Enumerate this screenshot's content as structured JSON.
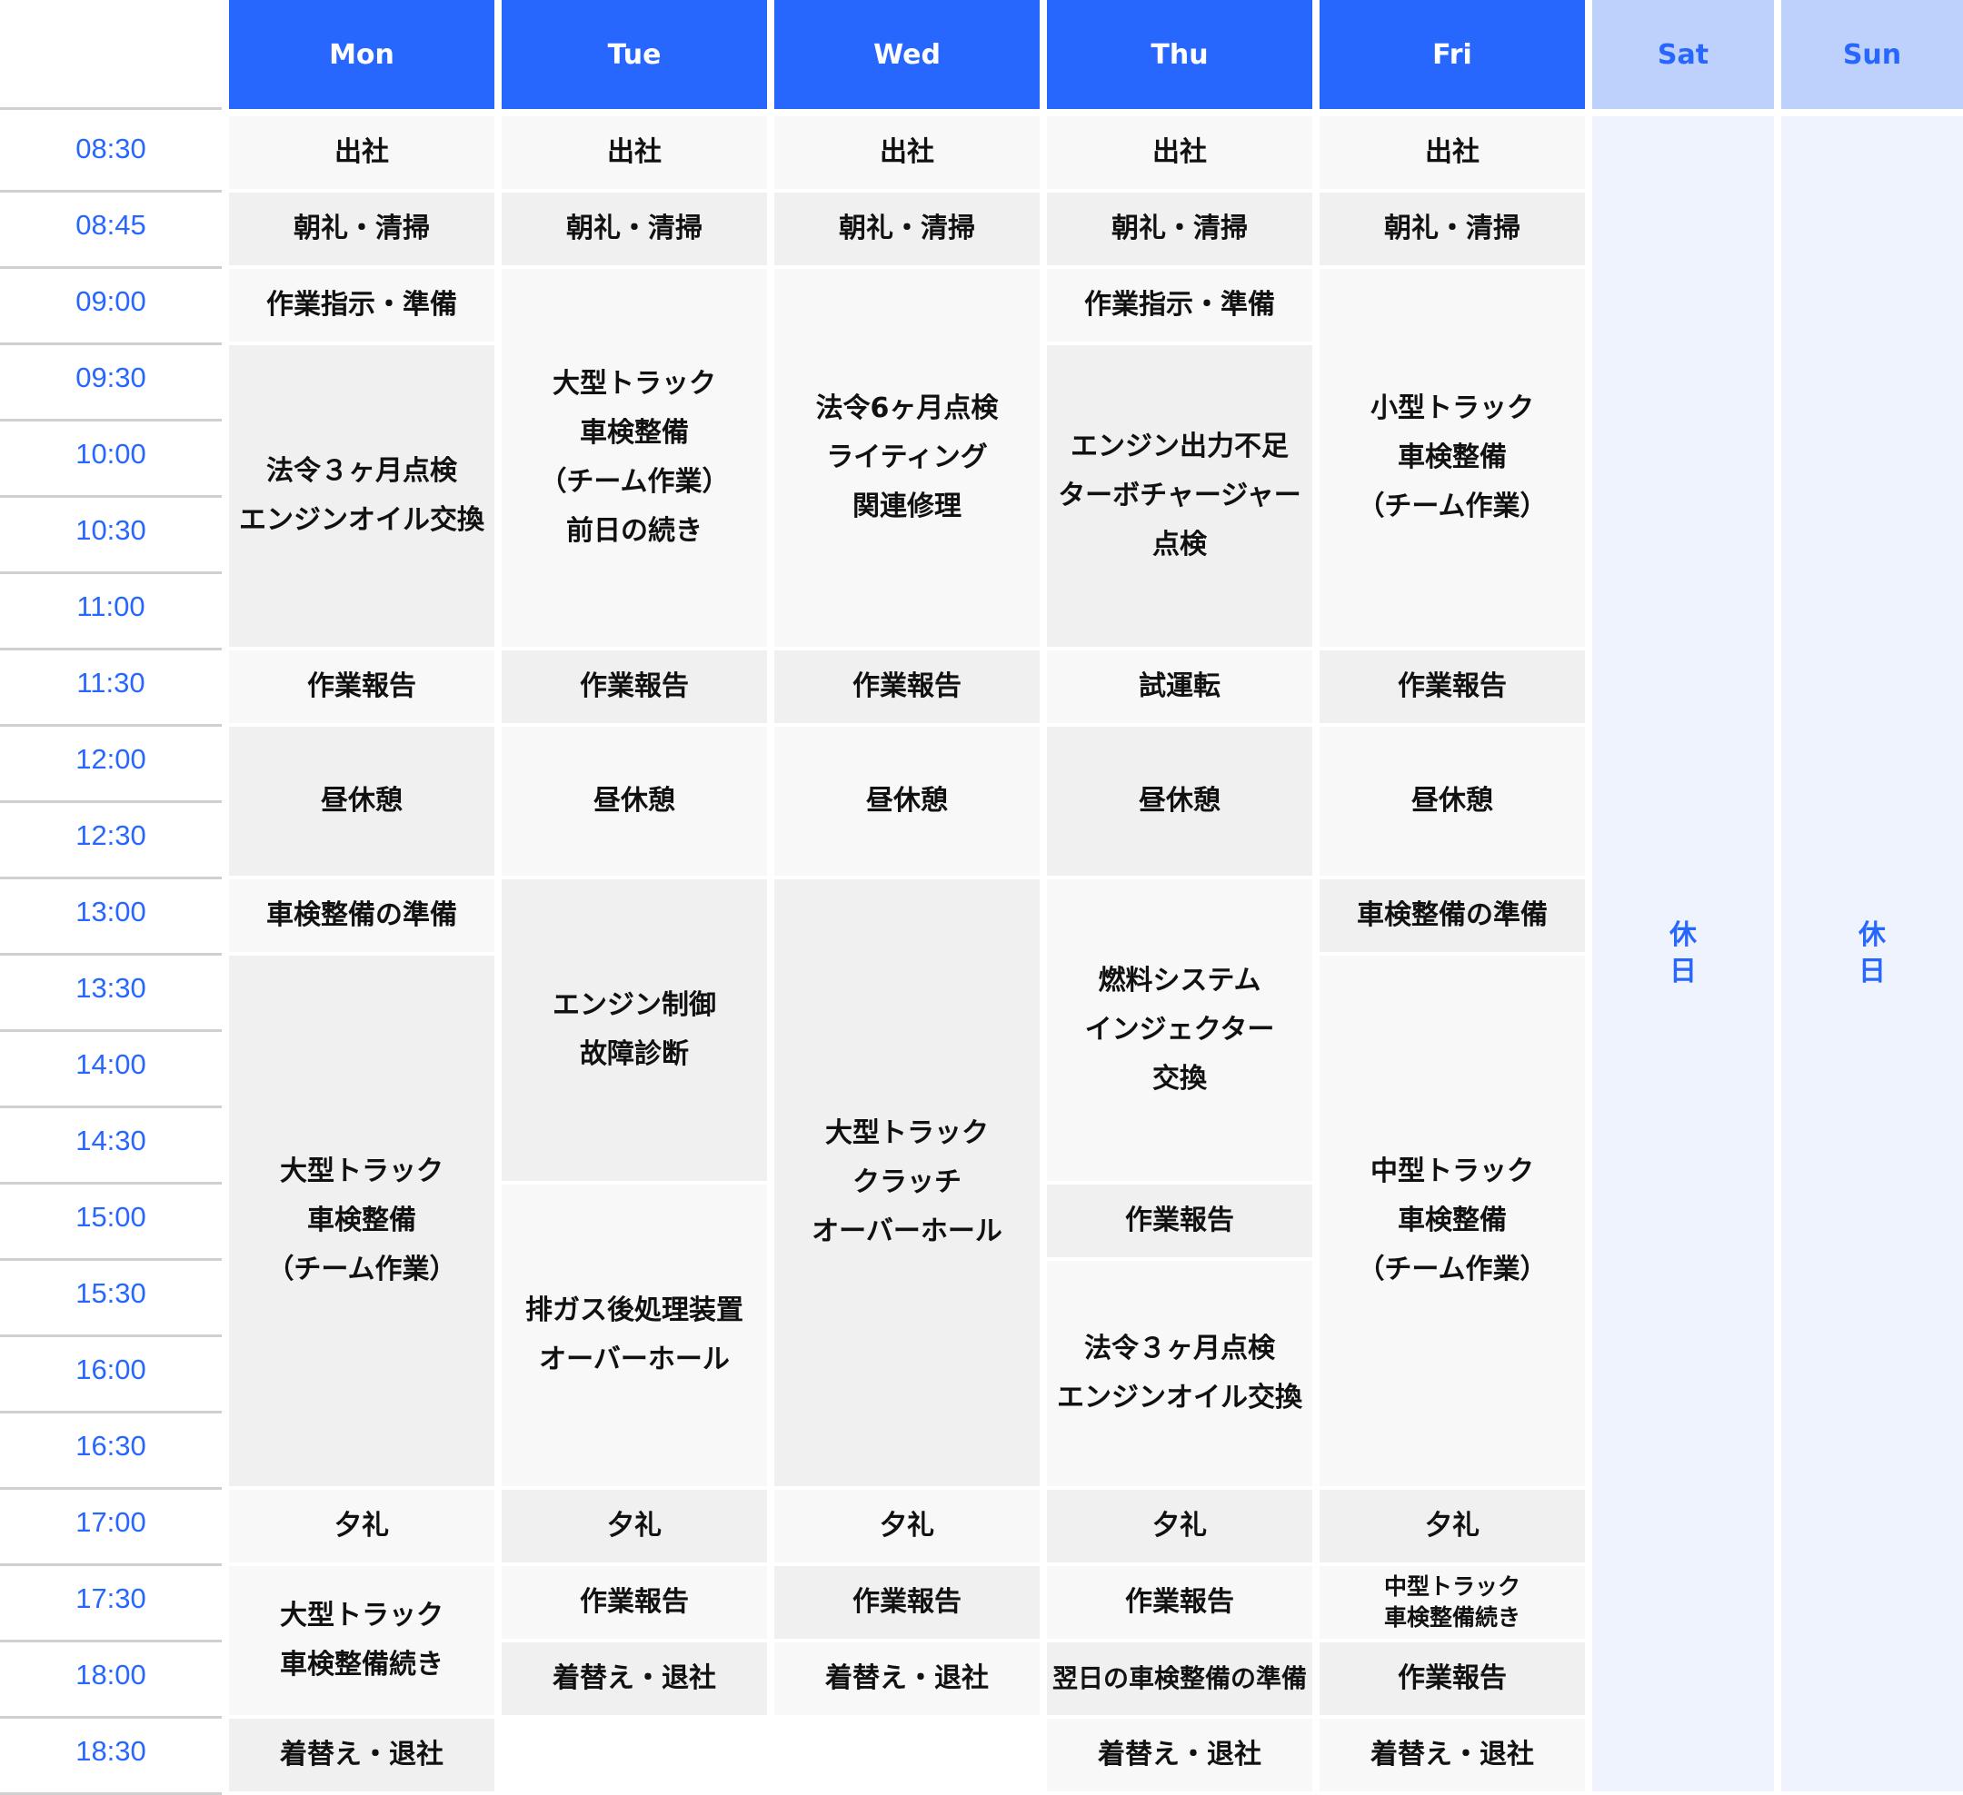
{
  "days": [
    {
      "label": "Mon",
      "type": "weekday"
    },
    {
      "label": "Tue",
      "type": "weekday"
    },
    {
      "label": "Wed",
      "type": "weekday"
    },
    {
      "label": "Thu",
      "type": "weekday"
    },
    {
      "label": "Fri",
      "type": "weekday"
    },
    {
      "label": "Sat",
      "type": "weekend"
    },
    {
      "label": "Sun",
      "type": "weekend"
    }
  ],
  "times": [
    "08:30",
    "08:45",
    "09:00",
    "09:30",
    "10:00",
    "10:30",
    "11:00",
    "11:30",
    "12:00",
    "12:30",
    "13:00",
    "13:30",
    "14:00",
    "14:30",
    "15:00",
    "15:30",
    "16:00",
    "16:30",
    "17:00",
    "17:30",
    "18:00",
    "18:30"
  ],
  "holiday_label": "休\n日",
  "colors": {
    "accent": "#2767fd",
    "weekend_header": "#bed1fc",
    "weekend_cell": "#eef3fe",
    "cell_light": "#f8f8f8",
    "cell_dark": "#f0f0f0"
  },
  "schedule": {
    "Mon": [
      {
        "text": "出社",
        "start": "08:30",
        "end": "08:45"
      },
      {
        "text": "朝礼・清掃",
        "start": "08:45",
        "end": "09:00"
      },
      {
        "text": "作業指示・準備",
        "start": "09:00",
        "end": "09:30"
      },
      {
        "text": "法令３ヶ月点検\nエンジンオイル交換",
        "start": "09:30",
        "end": "11:30"
      },
      {
        "text": "作業報告",
        "start": "11:30",
        "end": "12:00"
      },
      {
        "text": "昼休憩",
        "start": "12:00",
        "end": "13:00"
      },
      {
        "text": "車検整備の準備",
        "start": "13:00",
        "end": "13:30"
      },
      {
        "text": "大型トラック\n車検整備\n（チーム作業）",
        "start": "13:30",
        "end": "17:00"
      },
      {
        "text": "夕礼",
        "start": "17:00",
        "end": "17:30"
      },
      {
        "text": "大型トラック\n車検整備続き",
        "start": "17:30",
        "end": "18:30"
      },
      {
        "text": "着替え・退社",
        "start": "18:30",
        "end": "19:00"
      }
    ],
    "Tue": [
      {
        "text": "出社",
        "start": "08:30",
        "end": "08:45"
      },
      {
        "text": "朝礼・清掃",
        "start": "08:45",
        "end": "09:00"
      },
      {
        "text": "大型トラック\n車検整備\n（チーム作業）\n前日の続き",
        "start": "09:00",
        "end": "11:30"
      },
      {
        "text": "作業報告",
        "start": "11:30",
        "end": "12:00"
      },
      {
        "text": "昼休憩",
        "start": "12:00",
        "end": "13:00"
      },
      {
        "text": "エンジン制御\n故障診断",
        "start": "13:00",
        "end": "15:00"
      },
      {
        "text": "排ガス後処理装置\nオーバーホール",
        "start": "15:00",
        "end": "17:00"
      },
      {
        "text": "夕礼",
        "start": "17:00",
        "end": "17:30"
      },
      {
        "text": "作業報告",
        "start": "17:30",
        "end": "18:00"
      },
      {
        "text": "着替え・退社",
        "start": "18:00",
        "end": "18:30"
      }
    ],
    "Wed": [
      {
        "text": "出社",
        "start": "08:30",
        "end": "08:45"
      },
      {
        "text": "朝礼・清掃",
        "start": "08:45",
        "end": "09:00"
      },
      {
        "text": "法令6ヶ月点検\nライティング\n関連修理",
        "start": "09:00",
        "end": "11:30"
      },
      {
        "text": "作業報告",
        "start": "11:30",
        "end": "12:00"
      },
      {
        "text": "昼休憩",
        "start": "12:00",
        "end": "13:00"
      },
      {
        "text": "大型トラック\nクラッチ\nオーバーホール",
        "start": "13:00",
        "end": "17:00"
      },
      {
        "text": "夕礼",
        "start": "17:00",
        "end": "17:30"
      },
      {
        "text": "作業報告",
        "start": "17:30",
        "end": "18:00"
      },
      {
        "text": "着替え・退社",
        "start": "18:00",
        "end": "18:30"
      }
    ],
    "Thu": [
      {
        "text": "出社",
        "start": "08:30",
        "end": "08:45"
      },
      {
        "text": "朝礼・清掃",
        "start": "08:45",
        "end": "09:00"
      },
      {
        "text": "作業指示・準備",
        "start": "09:00",
        "end": "09:30"
      },
      {
        "text": "エンジン出力不足\nターボチャージャー\n点検",
        "start": "09:30",
        "end": "11:30"
      },
      {
        "text": "試運転",
        "start": "11:30",
        "end": "12:00"
      },
      {
        "text": "昼休憩",
        "start": "12:00",
        "end": "13:00"
      },
      {
        "text": "燃料システム\nインジェクター\n交換",
        "start": "13:00",
        "end": "15:00"
      },
      {
        "text": "作業報告",
        "start": "15:00",
        "end": "15:30"
      },
      {
        "text": "法令３ヶ月点検\nエンジンオイル交換",
        "start": "15:30",
        "end": "17:00"
      },
      {
        "text": "夕礼",
        "start": "17:00",
        "end": "17:30"
      },
      {
        "text": "作業報告",
        "start": "17:30",
        "end": "18:00"
      },
      {
        "text": "翌日の車検整備の準備",
        "start": "18:00",
        "end": "18:30"
      },
      {
        "text": "着替え・退社",
        "start": "18:30",
        "end": "19:00"
      }
    ],
    "Fri": [
      {
        "text": "出社",
        "start": "08:30",
        "end": "08:45"
      },
      {
        "text": "朝礼・清掃",
        "start": "08:45",
        "end": "09:00"
      },
      {
        "text": "小型トラック\n車検整備\n（チーム作業）",
        "start": "09:00",
        "end": "11:30"
      },
      {
        "text": "作業報告",
        "start": "11:30",
        "end": "12:00"
      },
      {
        "text": "昼休憩",
        "start": "12:00",
        "end": "13:00"
      },
      {
        "text": "車検整備の準備",
        "start": "13:00",
        "end": "13:30"
      },
      {
        "text": "中型トラック\n車検整備\n（チーム作業）",
        "start": "13:30",
        "end": "17:00"
      },
      {
        "text": "夕礼",
        "start": "17:00",
        "end": "17:30"
      },
      {
        "text": "中型トラック\n車検整備続き",
        "start": "17:30",
        "end": "18:00"
      },
      {
        "text": "作業報告",
        "start": "18:00",
        "end": "18:30"
      },
      {
        "text": "着替え・退社",
        "start": "18:30",
        "end": "19:00"
      }
    ]
  }
}
